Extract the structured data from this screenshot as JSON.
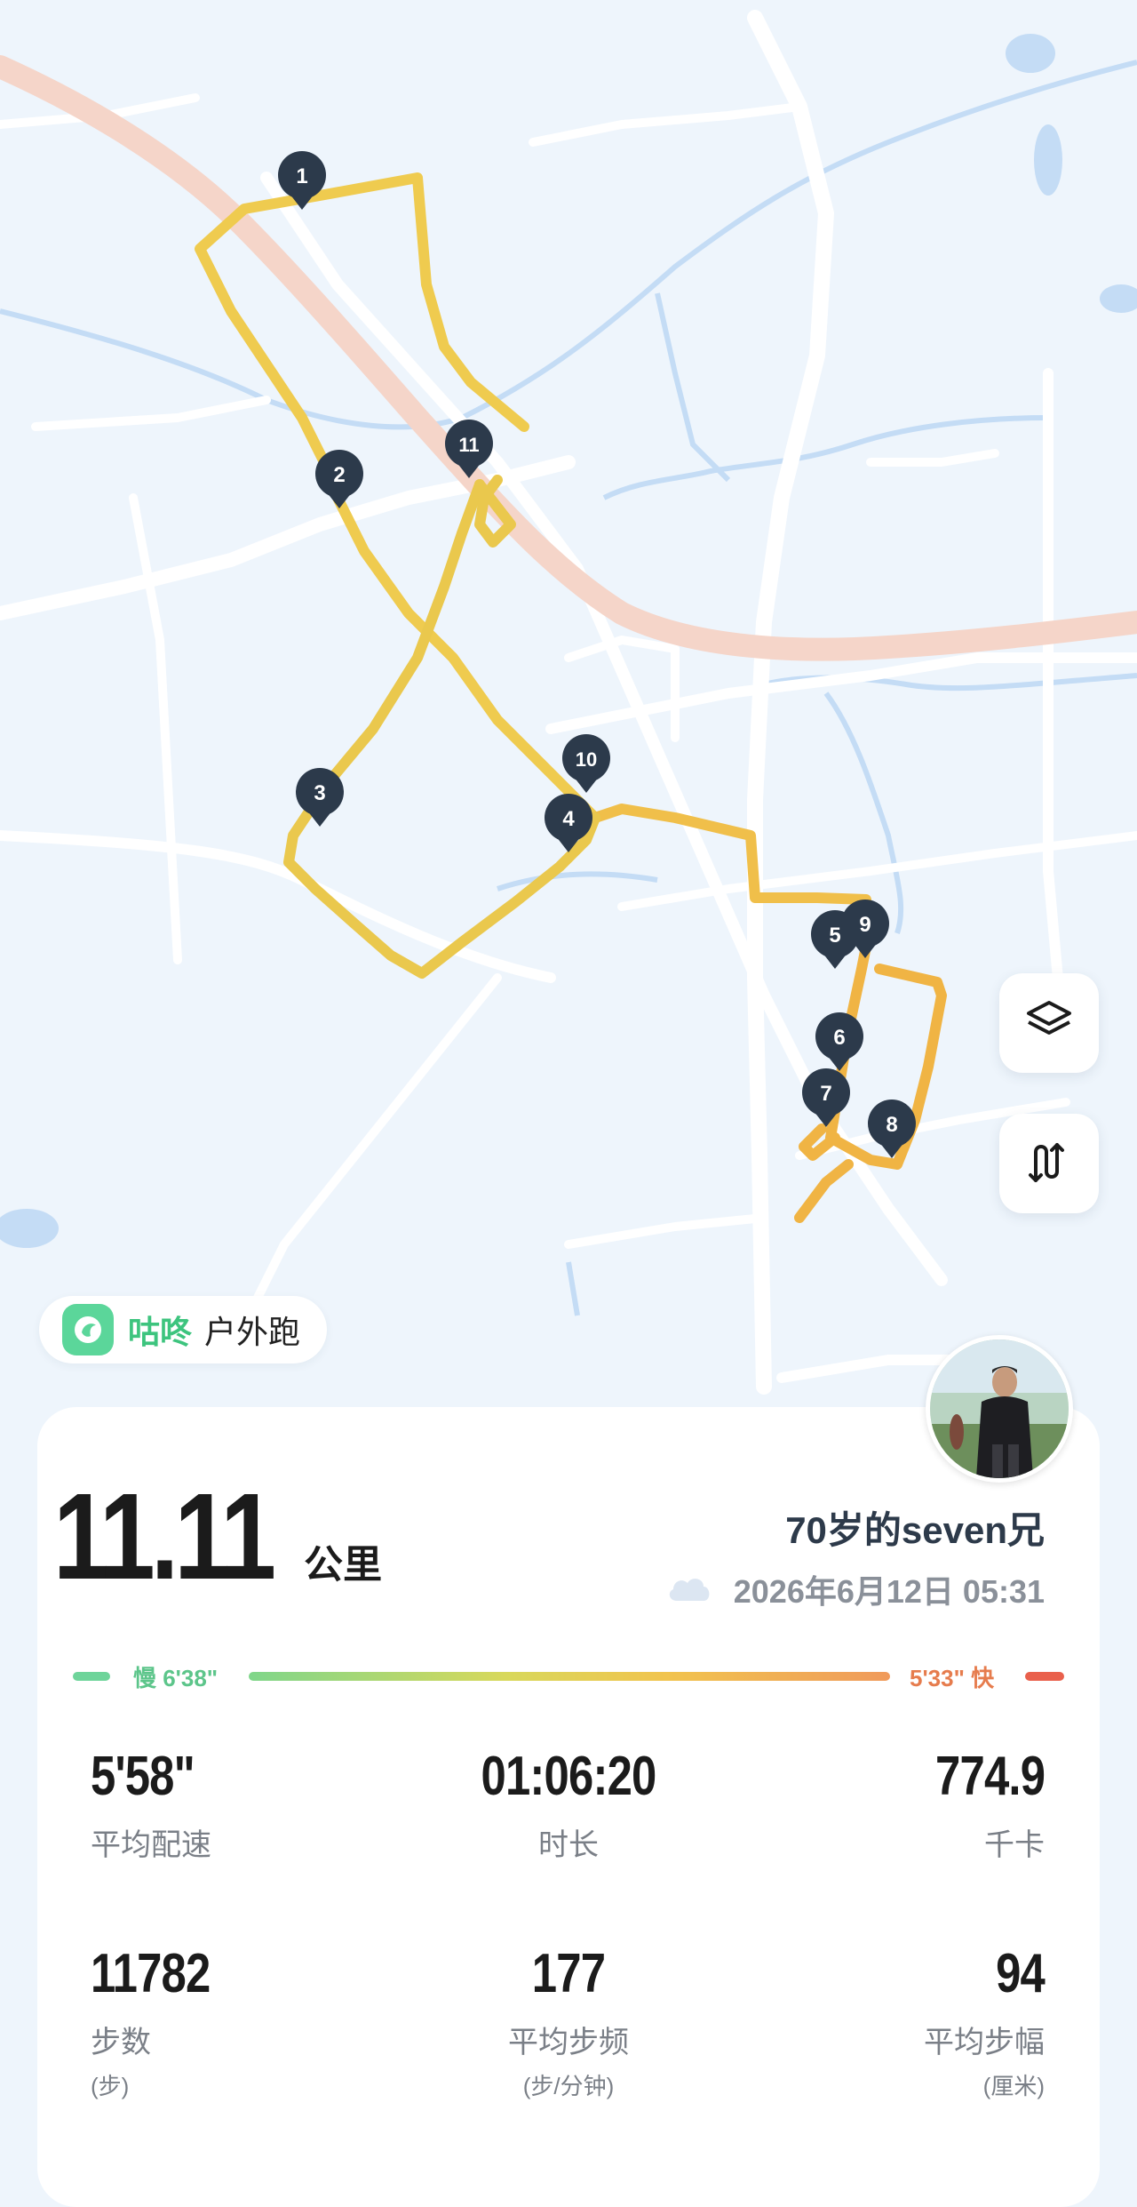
{
  "app": {
    "brand": "咕咚",
    "activity_type": "户外跑"
  },
  "map": {
    "markers": [
      "1",
      "2",
      "3",
      "4",
      "5",
      "6",
      "7",
      "8",
      "9",
      "10",
      "11"
    ],
    "controls": [
      "layers-icon",
      "route-icon"
    ]
  },
  "user": {
    "name": "70岁的seven兄",
    "datetime": "2026年6月12日 05:31",
    "weather_icon": "cloud-icon"
  },
  "summary": {
    "distance": "11.11",
    "distance_unit": "公里"
  },
  "pace_legend": {
    "slow": "慢 6'38\"",
    "fast": "5'33\" 快",
    "slow_color": "#6ed49a",
    "fast_color": "#e9604c"
  },
  "stats": [
    {
      "value": "5'58\"",
      "label": "平均配速",
      "unit": ""
    },
    {
      "value": "01:06:20",
      "label": "时长",
      "unit": ""
    },
    {
      "value": "774.9",
      "label": "千卡",
      "unit": ""
    },
    {
      "value": "11782",
      "label": "步数",
      "unit": "(步)"
    },
    {
      "value": "177",
      "label": "平均步频",
      "unit": "(步/分钟)"
    },
    {
      "value": "94",
      "label": "平均步幅",
      "unit": "(厘米)"
    }
  ],
  "colors": {
    "route": "#f0c94a",
    "brand": "#3dc47e",
    "marker": "#2c3a4b"
  }
}
